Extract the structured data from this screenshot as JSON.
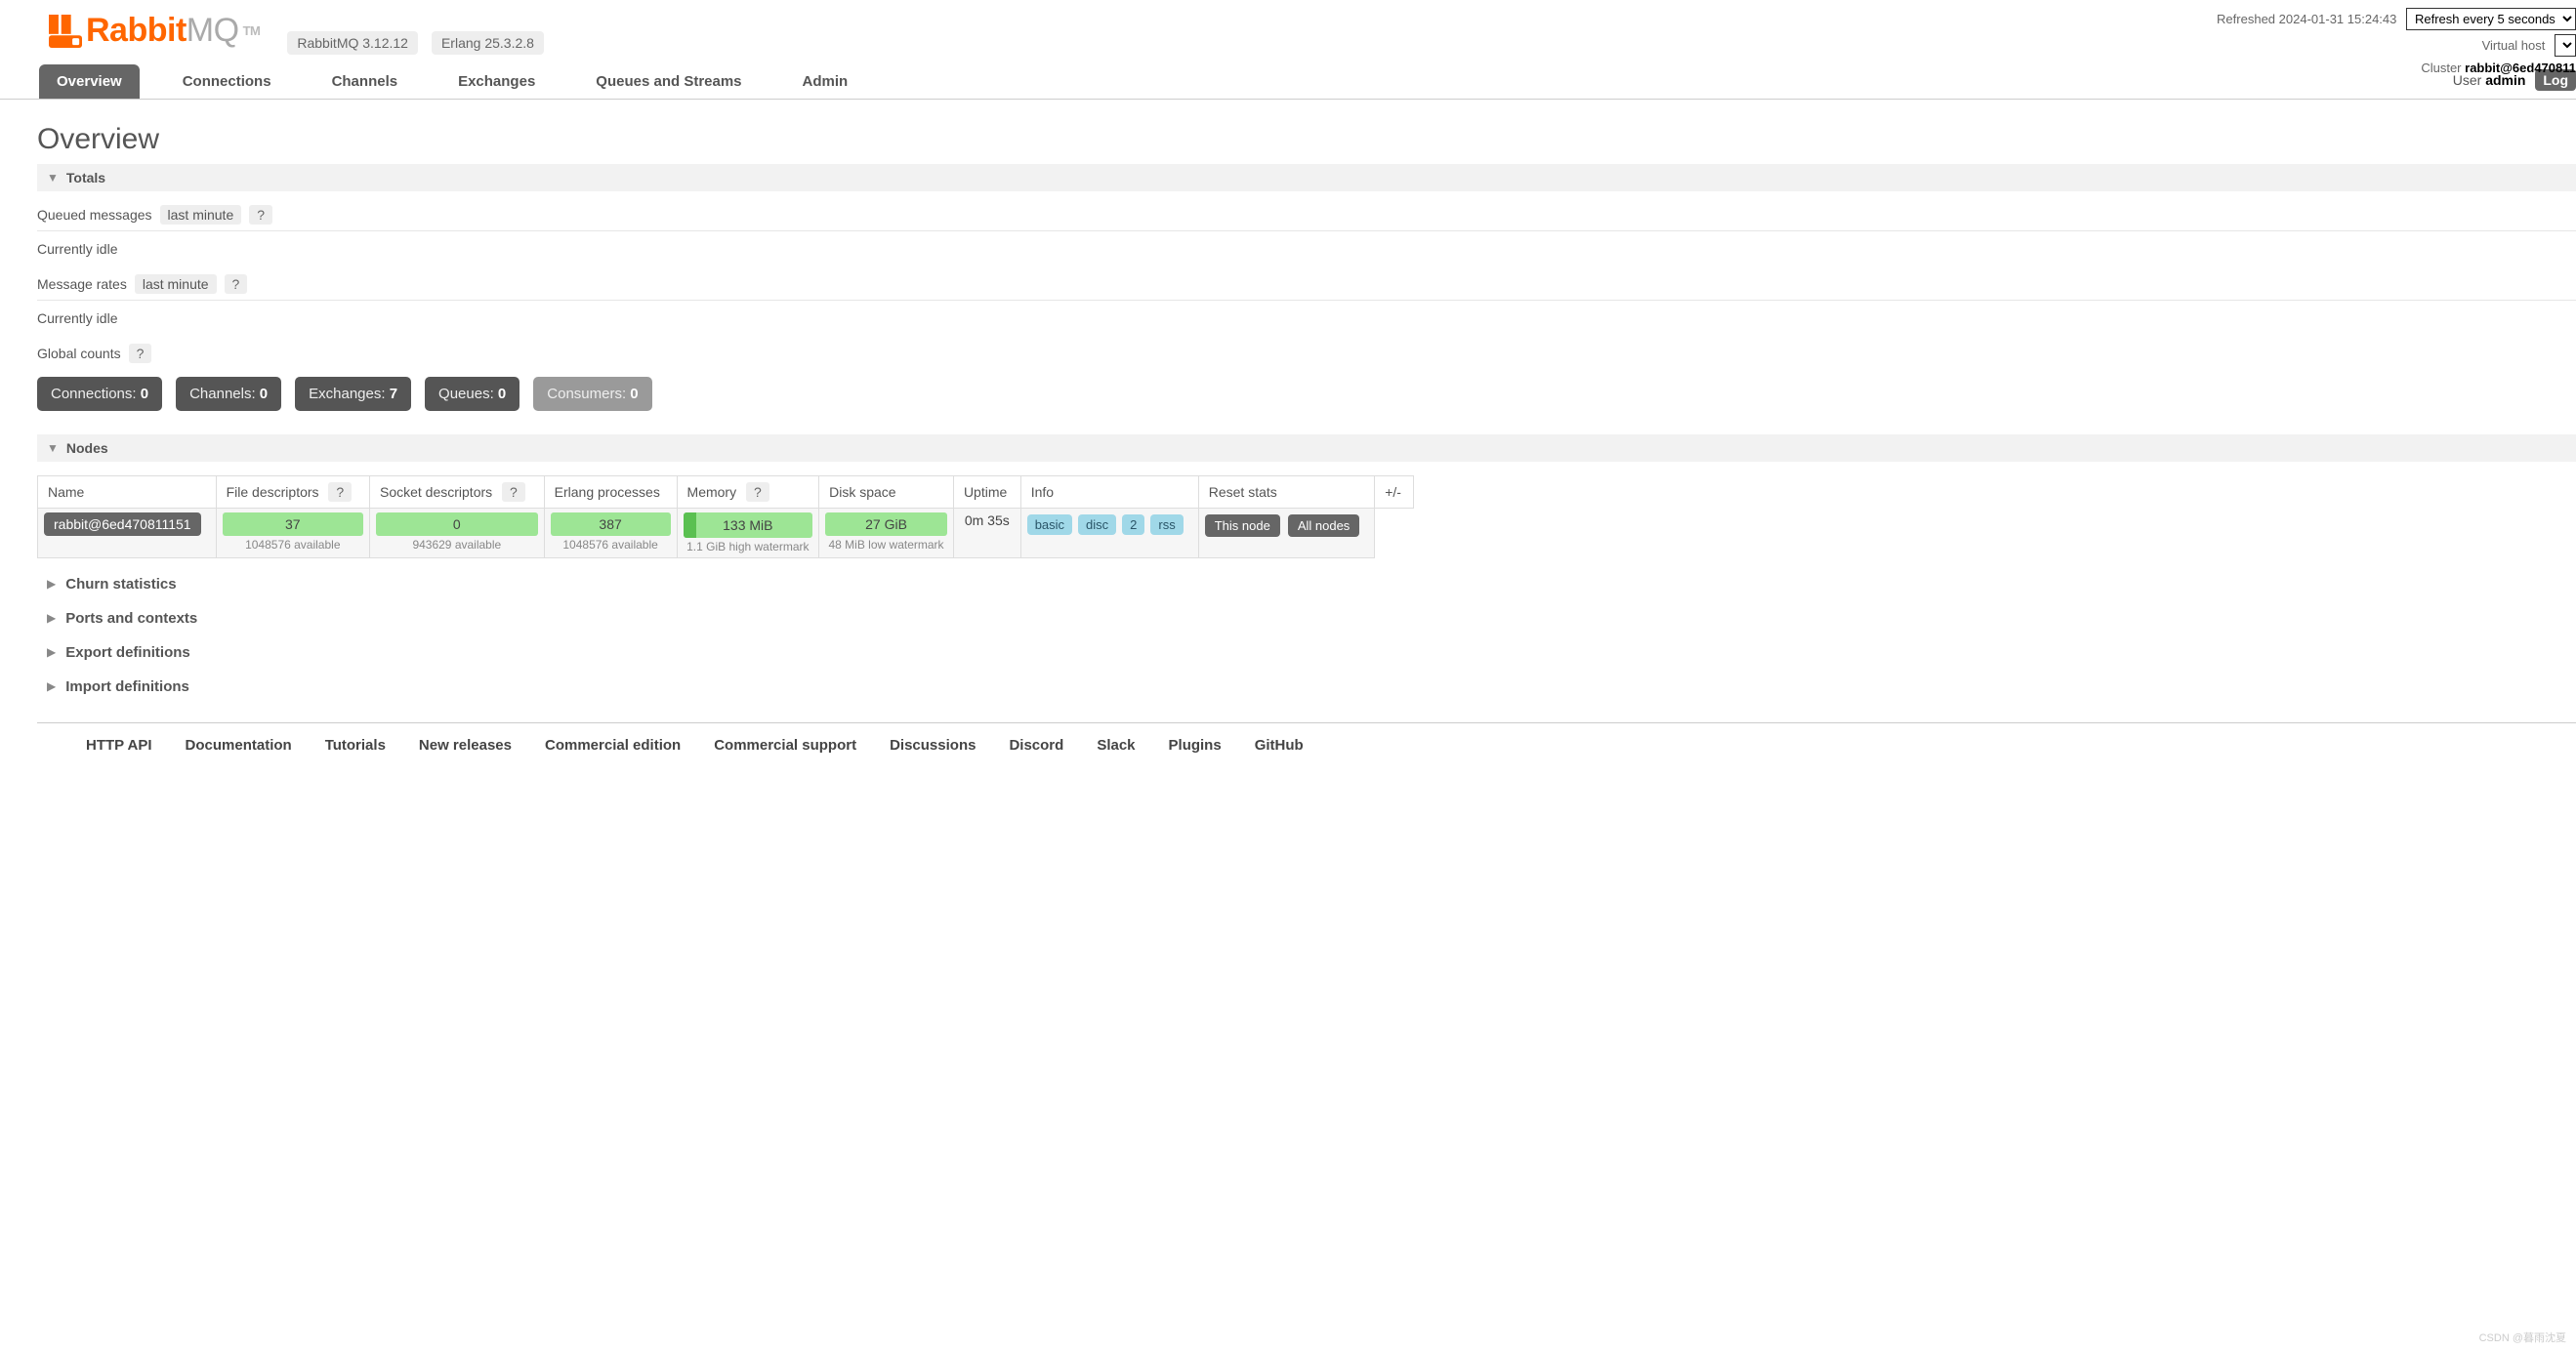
{
  "header": {
    "refreshed_label": "Refreshed",
    "refreshed_time": "2024-01-31 15:24:43",
    "refresh_select": "Refresh every 5 seconds",
    "vhost_label": "Virtual host",
    "cluster_label": "Cluster",
    "cluster_name": "rabbit@6ed470811",
    "user_label": "User",
    "user_name": "admin",
    "logout": "Log"
  },
  "brand": {
    "name_a": "Rabbit",
    "name_b": "MQ",
    "tm": "TM",
    "version": "RabbitMQ 3.12.12",
    "erlang": "Erlang 25.3.2.8"
  },
  "tabs": [
    "Overview",
    "Connections",
    "Channels",
    "Exchanges",
    "Queues and Streams",
    "Admin"
  ],
  "page_title": "Overview",
  "totals": {
    "title": "Totals",
    "queued_label": "Queued messages",
    "queued_range": "last minute",
    "help": "?",
    "idle1": "Currently idle",
    "rates_label": "Message rates",
    "rates_range": "last minute",
    "idle2": "Currently idle",
    "global_label": "Global counts",
    "counts": [
      {
        "label": "Connections:",
        "value": "0",
        "dis": false
      },
      {
        "label": "Channels:",
        "value": "0",
        "dis": false
      },
      {
        "label": "Exchanges:",
        "value": "7",
        "dis": false
      },
      {
        "label": "Queues:",
        "value": "0",
        "dis": false
      },
      {
        "label": "Consumers:",
        "value": "0",
        "dis": true
      }
    ]
  },
  "nodes": {
    "title": "Nodes",
    "headers": {
      "name": "Name",
      "fd": "File descriptors",
      "sd": "Socket descriptors",
      "ep": "Erlang processes",
      "mem": "Memory",
      "disk": "Disk space",
      "uptime": "Uptime",
      "info": "Info",
      "reset": "Reset stats",
      "pm": "+/-"
    },
    "row": {
      "name": "rabbit@6ed470811151",
      "fd": "37",
      "fd_sub": "1048576 available",
      "sd": "0",
      "sd_sub": "943629 available",
      "ep": "387",
      "ep_sub": "1048576 available",
      "mem": "133 MiB",
      "mem_sub": "1.1 GiB high watermark",
      "disk": "27 GiB",
      "disk_sub": "48 MiB low watermark",
      "uptime": "0m 35s",
      "info": [
        "basic",
        "disc",
        "2",
        "rss"
      ],
      "reset_this": "This node",
      "reset_all": "All nodes"
    }
  },
  "collapsed": [
    "Churn statistics",
    "Ports and contexts",
    "Export definitions",
    "Import definitions"
  ],
  "footer": [
    "HTTP API",
    "Documentation",
    "Tutorials",
    "New releases",
    "Commercial edition",
    "Commercial support",
    "Discussions",
    "Discord",
    "Slack",
    "Plugins",
    "GitHub"
  ],
  "watermark": "CSDN @暮雨沈夏"
}
